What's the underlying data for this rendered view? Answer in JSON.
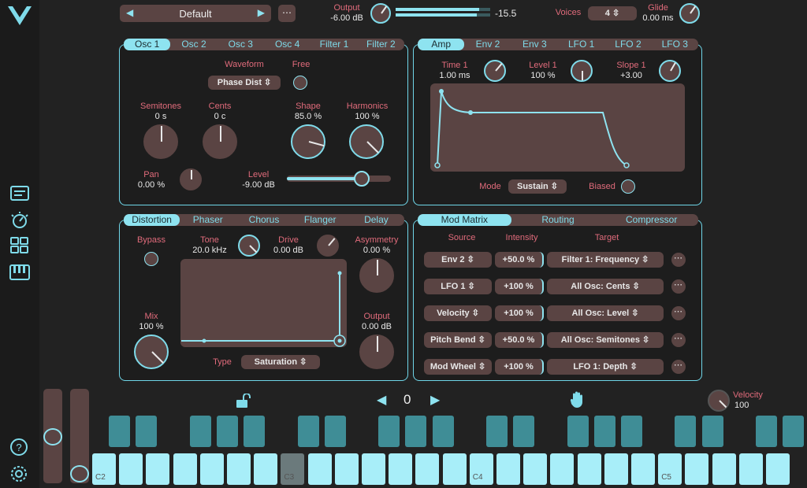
{
  "header": {
    "preset": "Default",
    "output_label": "Output",
    "output_value": "-6.00 dB",
    "meter_value": "-15.5",
    "voices_label": "Voices",
    "voices_value": "4",
    "glide_label": "Glide",
    "glide_value": "0.00 ms"
  },
  "osc": {
    "tabs": [
      "Osc 1",
      "Osc 2",
      "Osc 3",
      "Osc 4",
      "Filter 1",
      "Filter 2"
    ],
    "waveform_label": "Waveform",
    "waveform_value": "Phase Dist",
    "free_label": "Free",
    "semitones_label": "Semitones",
    "semitones_value": "0 s",
    "cents_label": "Cents",
    "cents_value": "0 c",
    "shape_label": "Shape",
    "shape_value": "85.0 %",
    "harmonics_label": "Harmonics",
    "harmonics_value": "100 %",
    "pan_label": "Pan",
    "pan_value": "0.00 %",
    "level_label": "Level",
    "level_value": "-9.00 dB",
    "level_fraction": 0.72
  },
  "env": {
    "tabs": [
      "Amp",
      "Env 2",
      "Env 3",
      "LFO 1",
      "LFO 2",
      "LFO 3"
    ],
    "time_label": "Time 1",
    "time_value": "1.00 ms",
    "level_label": "Level 1",
    "level_value": "100 %",
    "slope_label": "Slope 1",
    "slope_value": "+3.00",
    "mode_label": "Mode",
    "mode_value": "Sustain",
    "biased_label": "Biased"
  },
  "fx": {
    "tabs": [
      "Distortion",
      "Phaser",
      "Chorus",
      "Flanger",
      "Delay"
    ],
    "bypass_label": "Bypass",
    "tone_label": "Tone",
    "tone_value": "20.0 kHz",
    "drive_label": "Drive",
    "drive_value": "0.00 dB",
    "asym_label": "Asymmetry",
    "asym_value": "0.00 %",
    "mix_label": "Mix",
    "mix_value": "100 %",
    "output_label": "Output",
    "output_value": "0.00 dB",
    "type_label": "Type",
    "type_value": "Saturation"
  },
  "mod": {
    "tabs": [
      "Mod Matrix",
      "Routing",
      "Compressor"
    ],
    "source_header": "Source",
    "intensity_header": "Intensity",
    "target_header": "Target",
    "rows": [
      {
        "source": "Env 2",
        "intensity": "+50.0 %",
        "target": "Filter 1: Frequency"
      },
      {
        "source": "LFO 1",
        "intensity": "+100 %",
        "target": "All Osc: Cents"
      },
      {
        "source": "Velocity",
        "intensity": "+100 %",
        "target": "All Osc: Level"
      },
      {
        "source": "Pitch Bend",
        "intensity": "+50.0 %",
        "target": "All Osc: Semitones"
      },
      {
        "source": "Mod Wheel",
        "intensity": "+100 %",
        "target": "LFO 1: Depth"
      }
    ]
  },
  "keyboard": {
    "octave": "0",
    "velocity_label": "Velocity",
    "velocity_value": "100",
    "labels": [
      "C2",
      "C3",
      "C4",
      "C5"
    ]
  },
  "icons": {
    "more": "⋯",
    "chev": "⌃⌄"
  }
}
